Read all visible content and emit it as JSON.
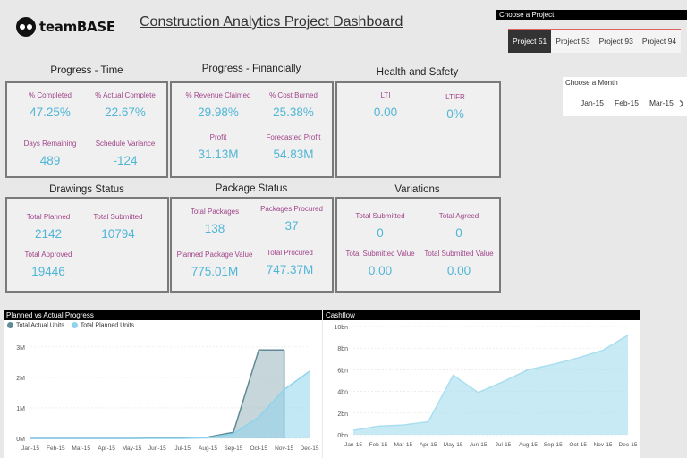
{
  "brand": {
    "logo_text": "teamBASE"
  },
  "header": {
    "title": "Construction Analytics Project Dashboard"
  },
  "project_slicer": {
    "label": "Choose a Project",
    "items": [
      {
        "label": "Project 51",
        "selected": true
      },
      {
        "label": "Project 53",
        "selected": false
      },
      {
        "label": "Project 93",
        "selected": false
      },
      {
        "label": "Project 94",
        "selected": false
      }
    ]
  },
  "month_slicer": {
    "label": "Choose a Month",
    "items": [
      "Jan-15",
      "Feb-15",
      "Mar-15"
    ],
    "next_icon": "chevron-right-icon"
  },
  "sections": {
    "progress_time": {
      "title": "Progress - Time",
      "kpis": [
        {
          "label": "% Completed",
          "value": "47.25%"
        },
        {
          "label": "% Actual Complete",
          "value": "22.67%"
        },
        {
          "label": "Days Remaining",
          "value": "489"
        },
        {
          "label": "Schedule Variance",
          "value": "-124"
        }
      ]
    },
    "progress_financial": {
      "title": "Progress - Financially",
      "kpis": [
        {
          "label": "% Revenue Claimed",
          "value": "29.98%"
        },
        {
          "label": "% Cost Burned",
          "value": "25.38%"
        },
        {
          "label": "Profit",
          "value": "31.13M"
        },
        {
          "label": "Forecasted Profit",
          "value": "54.83M"
        }
      ]
    },
    "health_safety": {
      "title": "Health and Safety",
      "kpis": [
        {
          "label": "LTI",
          "value": "0.00"
        },
        {
          "label": "LTIFR",
          "value": "0%"
        }
      ]
    },
    "drawings": {
      "title": "Drawings Status",
      "kpis": [
        {
          "label": "Total Planned",
          "value": "2142"
        },
        {
          "label": "Total Submitted",
          "value": "10794"
        },
        {
          "label": "Total Approved",
          "value": "19446"
        }
      ]
    },
    "package": {
      "title": "Package Status",
      "kpis": [
        {
          "label": "Total Packages",
          "value": "138"
        },
        {
          "label": "Packages Procured",
          "value": "37"
        },
        {
          "label": "Planned Package Value",
          "value": "775.01M"
        },
        {
          "label": "Total Procured",
          "value": "747.37M"
        }
      ]
    },
    "variations": {
      "title": "Variations",
      "kpis": [
        {
          "label": "Total Submitted",
          "value": "0"
        },
        {
          "label": "Total Agreed",
          "value": "0"
        },
        {
          "label": "Total Submitted Value",
          "value": "0.00"
        },
        {
          "label": "Total Submitted Value",
          "value": "0.00"
        }
      ]
    }
  },
  "chart_data": [
    {
      "type": "area",
      "title": "Planned vs Actual Progress",
      "categories": [
        "Jan-15",
        "Feb-15",
        "Mar-15",
        "Apr-15",
        "May-15",
        "Jun-15",
        "Jul-15",
        "Aug-15",
        "Sep-15",
        "Oct-15",
        "Nov-15",
        "Dec-15"
      ],
      "y_ticks": [
        "0M",
        "1M",
        "2M",
        "3M"
      ],
      "ylim": [
        0,
        3.2
      ],
      "series": [
        {
          "name": "Total Actual Units",
          "color": "#5f8a96",
          "values": [
            0,
            0,
            0,
            0,
            0,
            0.01,
            0.02,
            0.04,
            0.2,
            2.9,
            2.9,
            null
          ]
        },
        {
          "name": "Total Planned Units",
          "color": "#8fd3ec",
          "values": [
            0,
            0,
            0,
            0,
            0,
            0,
            0,
            0.02,
            0.15,
            0.7,
            1.6,
            2.2
          ]
        }
      ],
      "legend_position": "top-left"
    },
    {
      "type": "area",
      "title": "Cashflow",
      "categories": [
        "Jan-15",
        "Feb-15",
        "Mar-15",
        "Apr-15",
        "May-15",
        "Jun-15",
        "Jul-15",
        "Aug-15",
        "Sep-15",
        "Oct-15",
        "Nov-15",
        "Dec-15"
      ],
      "y_ticks": [
        "0bn",
        "2bn",
        "4bn",
        "6bn",
        "8bn",
        "10bn"
      ],
      "ylim": [
        0,
        10
      ],
      "series": [
        {
          "color": "#a9def0",
          "values": [
            0.4,
            0.8,
            0.9,
            1.2,
            5.5,
            3.9,
            4.9,
            6.0,
            6.5,
            7.1,
            7.8,
            9.2
          ]
        }
      ]
    }
  ]
}
